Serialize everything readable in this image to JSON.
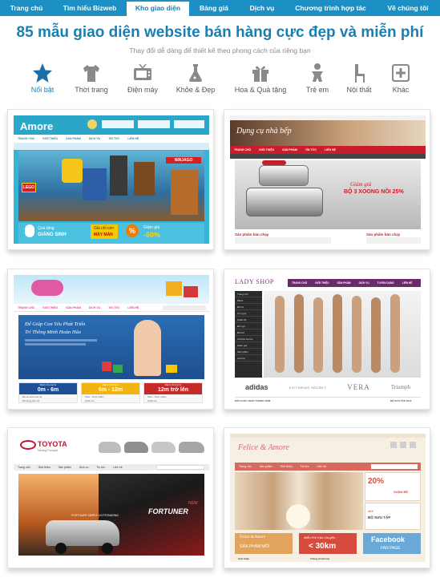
{
  "nav": {
    "items": [
      {
        "label": "Trang chủ",
        "width": 66
      },
      {
        "label": "Tìm hiểu Bizweb",
        "width": 92
      },
      {
        "label": "Kho giao diện",
        "width": 78,
        "active": true
      },
      {
        "label": "Bảng giá",
        "width": 62
      },
      {
        "label": "Dịch vụ",
        "width": 58
      },
      {
        "label": "Chương trình hợp tác",
        "width": 113
      },
      {
        "label": "Về chúng tôi",
        "width": 80
      }
    ]
  },
  "page": {
    "title": "85 mẫu giao diện website bán hàng cực đẹp và miễn phí",
    "subtitle": "Thay đổi dễ dàng để thiết kế theo phong cách của riêng bạn"
  },
  "categories": [
    {
      "label": "Nổi bật",
      "icon": "star-icon",
      "active": true
    },
    {
      "label": "Thời trang",
      "icon": "tshirt-icon"
    },
    {
      "label": "Điện máy",
      "icon": "tv-icon"
    },
    {
      "label": "Khỏe & Đẹp",
      "icon": "flask-icon"
    },
    {
      "label": "Hoa & Quà tặng",
      "icon": "gift-icon"
    },
    {
      "label": "Trẻ em",
      "icon": "baby-icon"
    },
    {
      "label": "Nội thất",
      "icon": "chair-icon"
    },
    {
      "label": "Khác",
      "icon": "plus-box-icon"
    }
  ],
  "themes": {
    "amore": {
      "logo": "Amore",
      "menu": [
        "TRANG CHỦ",
        "GIỚI THIỆU",
        "SẢN PHẨM",
        "DỊCH VỤ",
        "TIN TỨC",
        "LIÊN HỆ"
      ],
      "brand": "LEGO",
      "banner_ninjago": "NINJAGO",
      "gift_line1": "Quà tặng",
      "gift_line2": "GIÁNG SINH",
      "price_line1": "Giá chỉ còn",
      "price_line2": "MÁY MÀN",
      "sale_line1": "Giảm giá",
      "sale_line2": "-60%"
    },
    "kitchen": {
      "logo": "Dụng cụ nhà bếp",
      "menu": [
        "TRANG CHỦ",
        "GIỚI THIỆU",
        "SẢN PHẨM",
        "TIN TỨC",
        "LIÊN HỆ"
      ],
      "promo_small": "Giảm giá",
      "promo_big": "BỘ 3 XOONG NỒI 25%",
      "section_left": "Sản phẩm bán chạy",
      "section_right": "Sản phẩm bán chạy"
    },
    "kids": {
      "menu": [
        "TRANG CHỦ",
        "GIỚI THIỆU",
        "SẢN PHẨM",
        "DỊCH VỤ",
        "TIN TỨC",
        "LIÊN HỆ"
      ],
      "hero_line1": "Để Giúp Con Yêu Phát Triển",
      "hero_line2": "Trí Thông Minh Hoàn Hảo",
      "boxes": [
        {
          "top": "Dành cho bé từ",
          "range": "0m - 6m",
          "line1": "Đồ sơ sinh cho bé",
          "line2": "Đồ dùng tắm bé"
        },
        {
          "top": "Dành cho bé từ",
          "range": "6m - 12m",
          "line1": "Sữa - Thực phẩm",
          "line2": "Quần áo"
        },
        {
          "top": "Dành cho bé từ",
          "range": "12m trở lên",
          "line1": "Sữa - Thực phẩm",
          "line2": "Quần áo"
        }
      ]
    },
    "lady": {
      "logo": "LADY SHOP",
      "menu": [
        "TRANG CHỦ",
        "GIỚI THIỆU",
        "SẢN PHẨM",
        "DỊCH VỤ",
        "TUYỂN DỤNG",
        "LIÊN HỆ"
      ],
      "sidebar": [
        "Trang chủ",
        "Bikini",
        "Đồ lót",
        "Áo ngực",
        "Quần lót",
        "Đồ ngủ",
        "Đồ bơi",
        "Victoria Secret",
        "Giảm giá",
        "Sản phẩm",
        "Liên hệ"
      ],
      "brands": [
        "adidas",
        "VICTORIAS SECRET",
        "VERA",
        "Triumph"
      ],
      "footer_left": "BÁN CHẠY NHẤT TRONG NĂM",
      "footer_right": "BỘ SƯU TẬP 2013"
    },
    "toyota": {
      "logo": "TOYOTA",
      "tagline": "Moving Forward",
      "menu": [
        "Trang chủ",
        "Giới thiệu",
        "Sản phẩm",
        "Dịch vụ",
        "Tin tức",
        "Liên hệ"
      ],
      "car_new": "NEW",
      "car_name": "FORTUNER",
      "car_slogan": "FORTUNER SIMPLY OUTSTANDING"
    },
    "felice": {
      "logo": "Felice & Amore",
      "menu": [
        "Trang chủ",
        "Sản phẩm",
        "Giới thiệu",
        "Tin tức",
        "Liên hệ"
      ],
      "promo_pct": "20%",
      "promo_text": "XUÂN BỀ",
      "new_small": "Mới",
      "new_text": "BỘ SƯU TẬP",
      "tile1_a": "Felice & Amore",
      "tile1_b": "SẢN PHẨM MỚI",
      "tile2_a": "Miễn Phí Vận Chuyển",
      "tile2_b": "< 30km",
      "tile3_a": "Facebook",
      "tile3_b": "FAN PAGE",
      "footer_left": "Giới thiệu",
      "footer_right": "Thông tin liên hệ"
    }
  }
}
